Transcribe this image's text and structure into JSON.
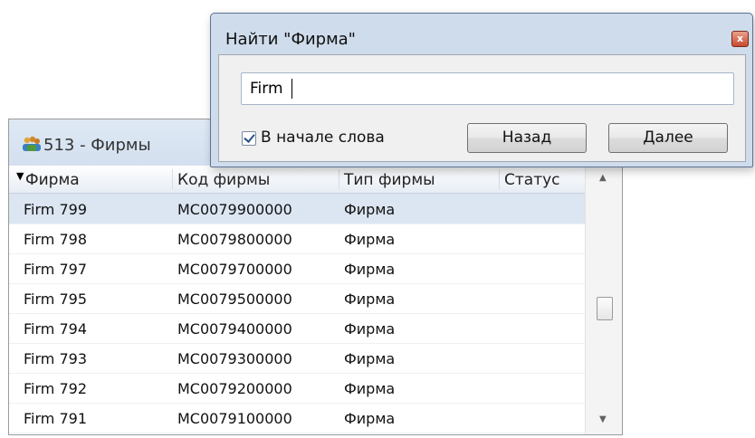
{
  "background_window": {
    "title": "513 - Фирмы",
    "icon": "users-group-icon",
    "columns": [
      "Фирма",
      "Код фирмы",
      "Тип фирмы",
      "Статус"
    ],
    "rows": [
      {
        "name": "Firm 799",
        "code": "MC0079900000",
        "type": "Фирма",
        "status": ""
      },
      {
        "name": "Firm 798",
        "code": "MC0079800000",
        "type": "Фирма",
        "status": ""
      },
      {
        "name": "Firm 797",
        "code": "MC0079700000",
        "type": "Фирма",
        "status": ""
      },
      {
        "name": "Firm 795",
        "code": "MC0079500000",
        "type": "Фирма",
        "status": ""
      },
      {
        "name": "Firm 794",
        "code": "MC0079400000",
        "type": "Фирма",
        "status": ""
      },
      {
        "name": "Firm 793",
        "code": "MC0079300000",
        "type": "Фирма",
        "status": ""
      },
      {
        "name": "Firm 792",
        "code": "MC0079200000",
        "type": "Фирма",
        "status": ""
      },
      {
        "name": "Firm 791",
        "code": "MC0079100000",
        "type": "Фирма",
        "status": ""
      }
    ],
    "selected_row": 0
  },
  "dialog": {
    "title": "Найти \"Фирма\"",
    "close_label": "x",
    "search_value": "Firm",
    "checkbox_label": "В начале слова",
    "checkbox_checked": true,
    "back_label": "Назад",
    "next_label": "Далее"
  },
  "colors": {
    "selection": "#dce6f2",
    "dialog_frame": "#cfdcec",
    "close_button": "#c7492f"
  }
}
